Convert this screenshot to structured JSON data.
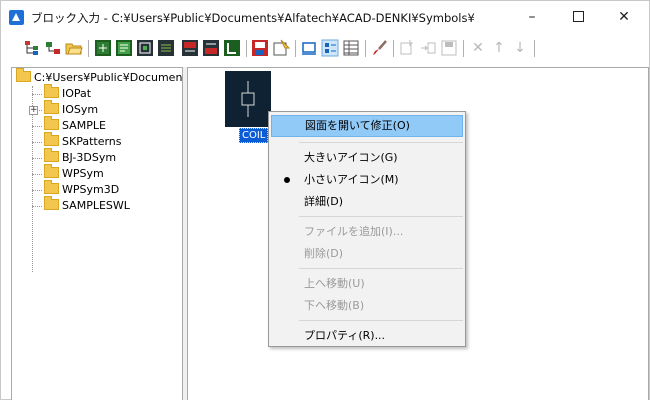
{
  "window": {
    "title": "ブロック入力 - C:¥Users¥Public¥Documents¥Alfatech¥ACAD-DENKI¥Symbols¥",
    "minimize_glyph": "–",
    "close_glyph": "✕"
  },
  "toolbar": {
    "icons": [
      "hierarchy-icon",
      "tree-icon",
      "open-folder-icon",
      "block-green-icon",
      "block-green-2-icon",
      "block-box-icon",
      "block-grid-icon",
      "block-red-icon",
      "block-red-2-icon",
      "block-export-icon",
      "block-save-icon",
      "properties-icon",
      "rectangle-icon",
      "small-icon-view-icon",
      "detail-view-icon",
      "brush-icon",
      "add-file-icon",
      "move-file-icon",
      "save-icon",
      "delete-icon",
      "move-up-icon",
      "move-down-icon"
    ],
    "disabled_glyphs": {
      "delete": "✕",
      "up": "↑",
      "down": "↓"
    }
  },
  "tree": {
    "root": "C:¥Users¥Public¥Document",
    "items": [
      "IOPat",
      "IOSym",
      "SAMPLE",
      "SKPatterns",
      "BJ-3DSym",
      "WPSym",
      "WPSym3D",
      "SAMPLESWL"
    ],
    "expander_glyph": "+"
  },
  "list": {
    "selected_item": "COIL"
  },
  "context_menu": {
    "items": [
      {
        "label": "図面を開いて修正(O)",
        "state": "highlighted"
      },
      {
        "label": "大きいアイコン(G)",
        "state": "normal"
      },
      {
        "label": "小さいアイコン(M)",
        "state": "checked"
      },
      {
        "label": "詳細(D)",
        "state": "normal"
      },
      {
        "label": "ファイルを追加(I)...",
        "state": "disabled"
      },
      {
        "label": "削除(D)",
        "state": "disabled"
      },
      {
        "label": "上へ移動(U)",
        "state": "disabled"
      },
      {
        "label": "下へ移動(B)",
        "state": "disabled"
      },
      {
        "label": "プロパティ(R)...",
        "state": "normal"
      }
    ]
  },
  "colors": {
    "highlight": "#91c9f7",
    "selection": "#0a5bd6",
    "thumbnail_bg": "#0e2233",
    "folder": "#f3c74d"
  }
}
